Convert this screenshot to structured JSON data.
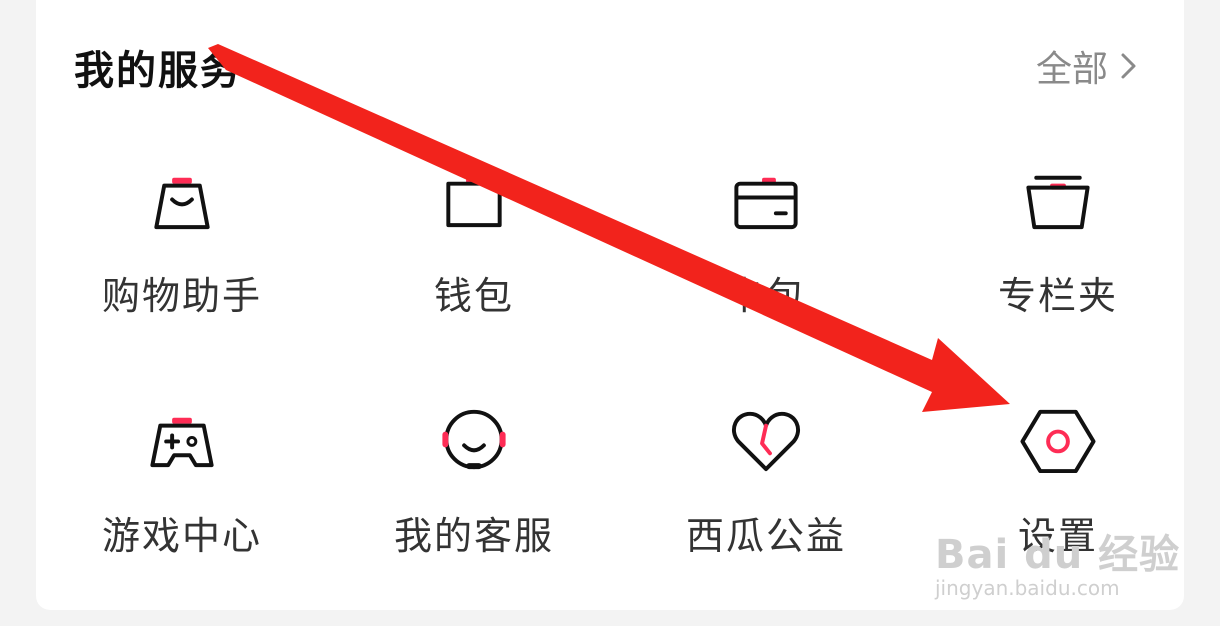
{
  "section": {
    "title": "我的服务",
    "all_label": "全部"
  },
  "services": [
    {
      "label": "购物助手",
      "icon": "shopping-bag-icon"
    },
    {
      "label": "钱包",
      "icon": "wallet-icon"
    },
    {
      "label": "卡包",
      "icon": "card-icon"
    },
    {
      "label": "专栏夹",
      "icon": "folder-icon"
    },
    {
      "label": "游戏中心",
      "icon": "gamepad-icon"
    },
    {
      "label": "我的客服",
      "icon": "headset-icon"
    },
    {
      "label": "西瓜公益",
      "icon": "heart-icon"
    },
    {
      "label": "设置",
      "icon": "hexagon-settings-icon"
    }
  ],
  "watermark": {
    "main": "Bai du 经验",
    "sub": "jingyan.baidu.com"
  },
  "colors": {
    "accent": "#fe2c55",
    "arrow": "#f2231c",
    "text": "#333333"
  }
}
